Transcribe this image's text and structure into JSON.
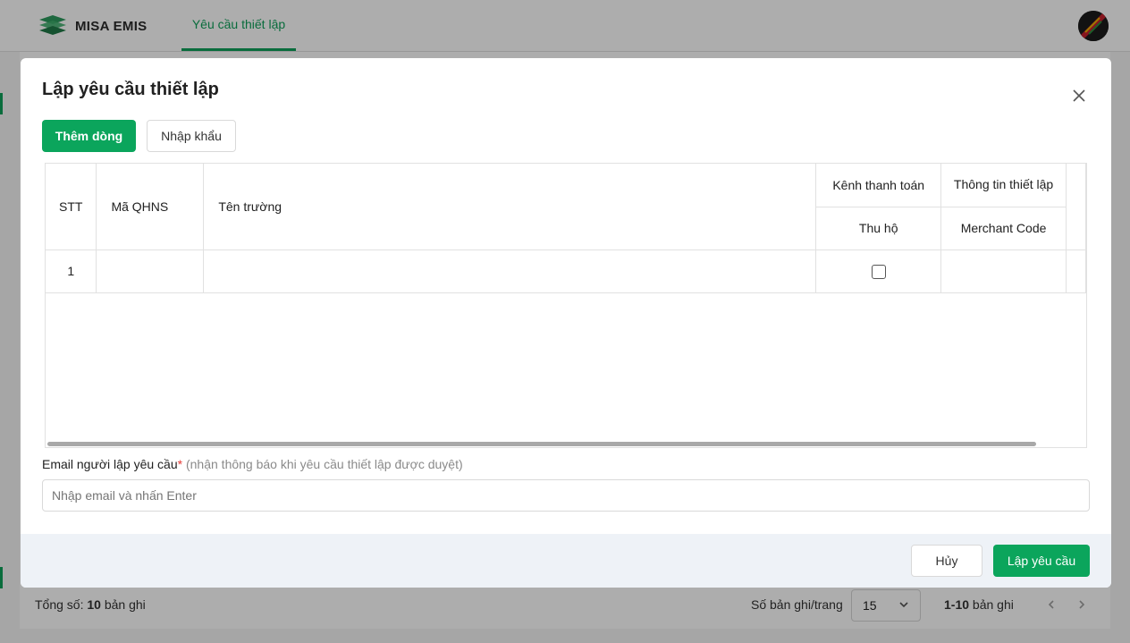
{
  "app": {
    "brand": "MISA EMIS",
    "nav_tab": "Yêu cầu thiết lập"
  },
  "footer": {
    "total_prefix": "Tổng số:",
    "total_count": "10",
    "total_suffix": "bản ghi",
    "per_page_label": "Số bản ghi/trang",
    "per_page_value": "15",
    "range": "1-10",
    "range_suffix": "bản ghi"
  },
  "modal": {
    "title": "Lập yêu cầu thiết lập",
    "add_row_label": "Thêm dòng",
    "import_label": "Nhập khẩu",
    "table": {
      "headers": {
        "stt": "STT",
        "ma_qhns": "Mã QHNS",
        "ten_truong": "Tên trường",
        "kenh_thanh_toan": "Kênh thanh toán",
        "thu_ho": "Thu hộ",
        "thong_tin_thiet_lap": "Thông tin thiết lập",
        "merchant_code": "Merchant Code"
      },
      "rows": [
        {
          "stt": "1",
          "ma_qhns": "",
          "ten_truong": "",
          "thu_ho": false,
          "merchant_code": ""
        }
      ]
    },
    "email": {
      "label": "Email người lập yêu cầu",
      "required_mark": "*",
      "hint": "(nhận thông báo khi yêu cầu thiết lập được duyệt)",
      "placeholder": "Nhập email và nhấn Enter",
      "value": ""
    },
    "cancel_label": "Hủy",
    "submit_label": "Lập yêu cầu"
  },
  "colors": {
    "accent": "#0ba55c",
    "overlay": "rgba(0,0,0,0.32)",
    "footer_bg": "#eef2f7",
    "required": "#e53935"
  },
  "icons": [
    "misa-logo-icon",
    "user-avatar-icon",
    "close-icon",
    "chevron-down-icon",
    "chevron-left-icon",
    "chevron-right-icon",
    "checkbox-icon"
  ]
}
